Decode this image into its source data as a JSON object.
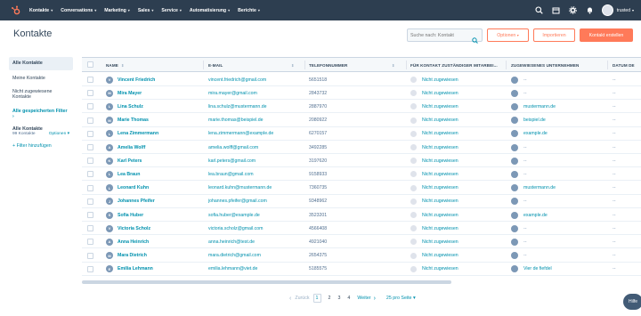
{
  "nav": {
    "items": [
      {
        "label": "Kontakte"
      },
      {
        "label": "Conversations"
      },
      {
        "label": "Marketing"
      },
      {
        "label": "Sales"
      },
      {
        "label": "Service"
      },
      {
        "label": "Automatisierung"
      },
      {
        "label": "Berichte"
      }
    ],
    "account": "trusted"
  },
  "page": {
    "title": "Kontakte",
    "search_placeholder": "Suche nach: Kontakt",
    "options_label": "Optionen",
    "import_label": "Importieren",
    "create_label": "Kontakt erstellen"
  },
  "sidebar": {
    "active": "Alle Kontakte",
    "my_contacts": "Meine Kontakte",
    "unassigned": "Nicht zugewiesene Kontakte",
    "saved_filters": "Alle gespeicherten Filter",
    "all_contacts_title": "Alle Kontakte",
    "count": "99 Kontakte",
    "options": "Optionen",
    "add_filter": "Filter hinzufügen"
  },
  "table": {
    "columns": [
      "NAME",
      "E-MAIL",
      "TELEFONNUMMER",
      "FÜR KONTAKT ZUSTÄNDIGER MITARBEI...",
      "ZUGEWIESENES UNTERNEHMEN",
      "DATUM DE"
    ],
    "rows": [
      {
        "initial": "V",
        "name": "Vincent Friedrich",
        "email": "vincent.friedrich@gmail.com",
        "phone": "5651518",
        "owner": "Nicht zugewiesen",
        "company": "--",
        "date": "--"
      },
      {
        "initial": "M",
        "name": "Mira Mayer",
        "email": "mira.mayer@gmail.com",
        "phone": "2843732",
        "owner": "Nicht zugewiesen",
        "company": "--",
        "date": "--"
      },
      {
        "initial": "L",
        "name": "Lina Schulz",
        "email": "lina.schulz@mustermann.de",
        "phone": "2887970",
        "owner": "Nicht zugewiesen",
        "company": "mustermann.de",
        "date": "--"
      },
      {
        "initial": "M",
        "name": "Marie Thomas",
        "email": "marie.thomas@beispiel.de",
        "phone": "2080922",
        "owner": "Nicht zugewiesen",
        "company": "beispiel.de",
        "date": "--"
      },
      {
        "initial": "L",
        "name": "Lena Zimmermann",
        "email": "lena.zimmermann@example.de",
        "phone": "6270157",
        "owner": "Nicht zugewiesen",
        "company": "example.de",
        "date": "--"
      },
      {
        "initial": "A",
        "name": "Amelia Wolff",
        "email": "amelia.wolff@gmail.com",
        "phone": "3492285",
        "owner": "Nicht zugewiesen",
        "company": "--",
        "date": "--"
      },
      {
        "initial": "K",
        "name": "Karl Peters",
        "email": "karl.peters@gmail.com",
        "phone": "3197620",
        "owner": "Nicht zugewiesen",
        "company": "--",
        "date": "--"
      },
      {
        "initial": "L",
        "name": "Lea Braun",
        "email": "lea.braun@gmail.com",
        "phone": "9158933",
        "owner": "Nicht zugewiesen",
        "company": "--",
        "date": "--"
      },
      {
        "initial": "L",
        "name": "Leonard Kuhn",
        "email": "leonard.kuhn@mustermann.de",
        "phone": "7360735",
        "owner": "Nicht zugewiesen",
        "company": "mustermann.de",
        "date": "--"
      },
      {
        "initial": "J",
        "name": "Johannes Pfeifer",
        "email": "johannes.pfeifer@gmail.com",
        "phone": "9348962",
        "owner": "Nicht zugewiesen",
        "company": "--",
        "date": "--"
      },
      {
        "initial": "S",
        "name": "Sofia Huber",
        "email": "sofia.huber@example.de",
        "phone": "3523201",
        "owner": "Nicht zugewiesen",
        "company": "example.de",
        "date": "--"
      },
      {
        "initial": "V",
        "name": "Victoria Scholz",
        "email": "victoria.scholz@gmail.com",
        "phone": "4566408",
        "owner": "Nicht zugewiesen",
        "company": "--",
        "date": "--"
      },
      {
        "initial": "A",
        "name": "Anna Heinrich",
        "email": "anna.heinrich@test.de",
        "phone": "4921040",
        "owner": "Nicht zugewiesen",
        "company": "--",
        "date": "--"
      },
      {
        "initial": "M",
        "name": "Mara Dietrich",
        "email": "mara.dietrich@gmail.com",
        "phone": "2654375",
        "owner": "Nicht zugewiesen",
        "company": "--",
        "date": "--"
      },
      {
        "initial": "E",
        "name": "Emilia Lehmann",
        "email": "emilia.lehmann@viet.de",
        "phone": "5185575",
        "owner": "Nicht zugewiesen",
        "company": "Vier de fiefdel",
        "date": "--"
      }
    ]
  },
  "pagination": {
    "prev": "Zurück",
    "pages": [
      "1",
      "2",
      "3",
      "4"
    ],
    "next": "Weiter",
    "per_page": "25 pro Seite"
  },
  "help": "Hilfe",
  "colors": {
    "nav_bg": "#2d3e50",
    "accent": "#ff7a59",
    "link": "#0091ae"
  }
}
